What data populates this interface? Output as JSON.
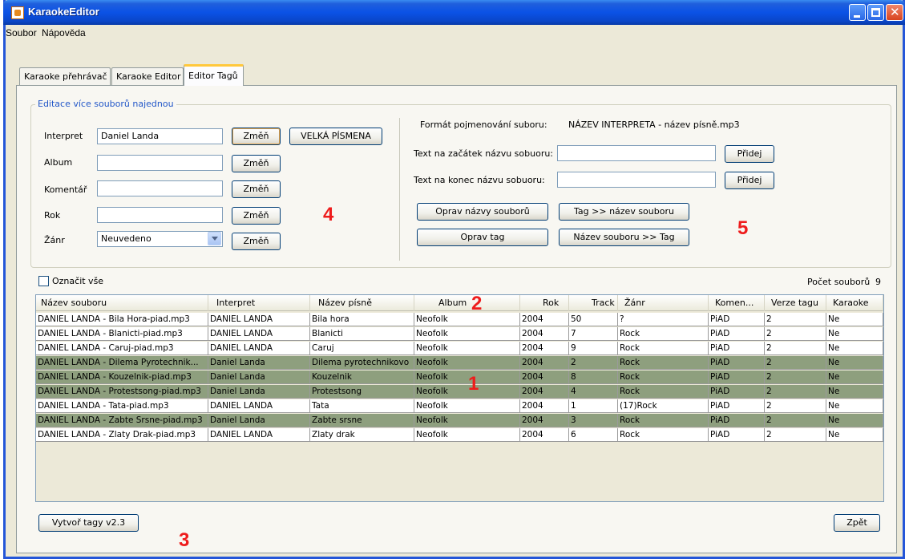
{
  "window": {
    "title": "KaraokeEditor"
  },
  "menu": {
    "items": [
      "Soubor",
      "Nápověda"
    ]
  },
  "tabs": [
    {
      "label": "Karaoke přehrávač",
      "active": false
    },
    {
      "label": "Karaoke Editor",
      "active": false
    },
    {
      "label": "Editor Tagů",
      "active": true
    }
  ],
  "batch_edit": {
    "legend": "Editace více souborů najednou",
    "change_label": "Změň",
    "uppercase_button": "VELKÁ PÍSMENA",
    "fields": {
      "artist": {
        "label": "Interpret",
        "value": "Daniel Landa"
      },
      "album": {
        "label": "Album",
        "value": ""
      },
      "comment": {
        "label": "Komentář",
        "value": ""
      },
      "year": {
        "label": "Rok",
        "value": ""
      },
      "genre": {
        "label": "Žánr",
        "value": "Neuvedeno"
      }
    }
  },
  "naming": {
    "format_label": "Formát pojmenování suboru:",
    "format_value": "NÁZEV INTERPRETA - název písně.mp3",
    "prefix_label": "Text na začátek názvu sobuoru:",
    "prefix_value": "",
    "suffix_label": "Text na konec názvu sobuoru:",
    "suffix_value": "",
    "add_label": "Přidej",
    "fix_names_button": "Oprav názvy souborů",
    "tag_to_name_button": "Tag >> název souboru",
    "fix_tag_button": "Oprav tag",
    "name_to_tag_button": "Název souboru >> Tag"
  },
  "select_all": {
    "label": "Označit vše",
    "checked": false
  },
  "file_count": {
    "label": "Počet souborů",
    "value": "9"
  },
  "table": {
    "columns": [
      "Název souboru",
      "Interpret",
      "Název písně",
      "Album",
      "Rok",
      "Track",
      "Žánr",
      "Komen...",
      "Verze tagu",
      "Karaoke"
    ],
    "rows": [
      {
        "cells": [
          "DANIEL LANDA - Bila Hora-piad.mp3",
          "DANIEL LANDA",
          "Bila hora",
          "Neofolk",
          "2004",
          "50",
          "?",
          "PiAD",
          "2",
          "Ne"
        ],
        "highlighted": false
      },
      {
        "cells": [
          "DANIEL LANDA - Blanicti-piad.mp3",
          "DANIEL LANDA",
          "Blanicti",
          "Neofolk",
          "2004",
          "7",
          "Rock",
          "PiAD",
          "2",
          "Ne"
        ],
        "highlighted": false
      },
      {
        "cells": [
          "DANIEL LANDA - Caruj-piad.mp3",
          "DANIEL LANDA",
          "Caruj",
          "Neofolk",
          "2004",
          "9",
          "Rock",
          "PiAD",
          "2",
          "Ne"
        ],
        "highlighted": false
      },
      {
        "cells": [
          "DANIEL LANDA - Dilema Pyrotechnik...",
          "Daniel Landa",
          "Dilema pyrotechnikovo",
          "Neofolk",
          "2004",
          "2",
          "Rock",
          "PiAD",
          "2",
          "Ne"
        ],
        "highlighted": true
      },
      {
        "cells": [
          "DANIEL LANDA - Kouzelnik-piad.mp3",
          "Daniel Landa",
          "Kouzelnik",
          "Neofolk",
          "2004",
          "8",
          "Rock",
          "PiAD",
          "2",
          "Ne"
        ],
        "highlighted": true
      },
      {
        "cells": [
          "DANIEL LANDA - Protestsong-piad.mp3",
          "Daniel Landa",
          "Protestsong",
          "Neofolk",
          "2004",
          "4",
          "Rock",
          "PiAD",
          "2",
          "Ne"
        ],
        "highlighted": true
      },
      {
        "cells": [
          "DANIEL LANDA - Tata-piad.mp3",
          "DANIEL LANDA",
          "Tata",
          "Neofolk",
          "2004",
          "1",
          "(17)Rock",
          "PiAD",
          "2",
          "Ne"
        ],
        "highlighted": false
      },
      {
        "cells": [
          "DANIEL LANDA - Zabte Srsne-piad.mp3",
          "Daniel Landa",
          "Zabte srsne",
          "Neofolk",
          "2004",
          "3",
          "Rock",
          "PiAD",
          "2",
          "Ne"
        ],
        "highlighted": true
      },
      {
        "cells": [
          "DANIEL LANDA - Zlaty Drak-piad.mp3",
          "DANIEL LANDA",
          "Zlaty drak",
          "Neofolk",
          "2004",
          "6",
          "Rock",
          "PiAD",
          "2",
          "Ne"
        ],
        "highlighted": false
      }
    ]
  },
  "footer": {
    "create_tags_button": "Vytvoř tagy v2.3",
    "back_button": "Zpět"
  },
  "annotations": [
    "1",
    "2",
    "3",
    "4",
    "5"
  ],
  "colors": {
    "highlight_row": "#8e9f7e",
    "annotation": "#ee1c1c",
    "titlebar": "#0b52e6",
    "active_tab_accent": "#ffc83c"
  },
  "icons": [
    "java-app-icon",
    "minimize-icon",
    "maximize-icon",
    "close-icon",
    "dropdown-arrow-icon"
  ]
}
